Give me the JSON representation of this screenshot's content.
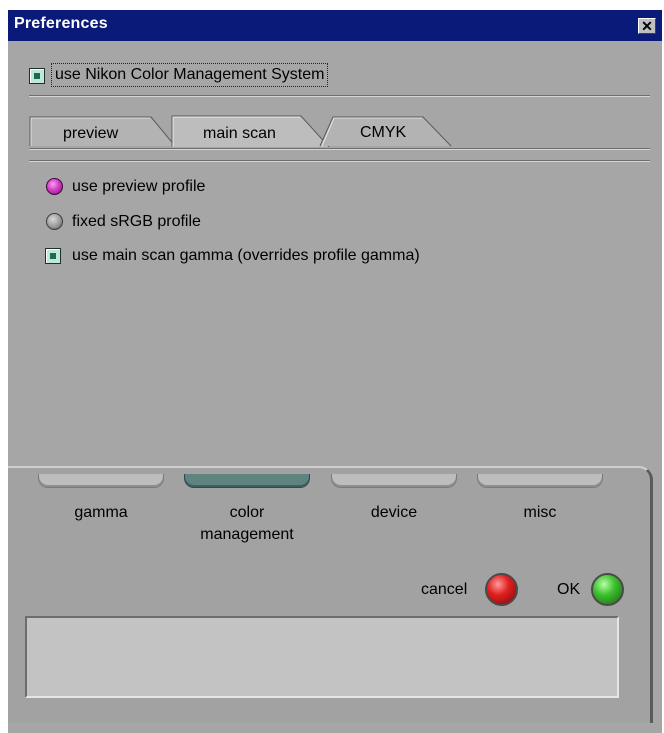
{
  "window": {
    "title": "Preferences"
  },
  "cms": {
    "label": "use Nikon Color Management System",
    "checked": true
  },
  "tabs": [
    {
      "label": "preview",
      "active": false
    },
    {
      "label": "main scan",
      "active": true
    },
    {
      "label": "CMYK",
      "active": false
    }
  ],
  "options": {
    "preview_profile": "use preview profile",
    "srgb_profile": "fixed sRGB profile",
    "main_scan_gamma": "use main scan gamma (overrides profile gamma)"
  },
  "nav": {
    "gamma": "gamma",
    "color_line1": "color",
    "color_line2": "management",
    "device": "device",
    "misc": "misc"
  },
  "actions": {
    "cancel": "cancel",
    "ok": "OK"
  },
  "colors": {
    "titlebar": "#0a1a78",
    "panel": "#a6a6a6",
    "accent_radio": "#d23ec6",
    "active_nav": "#5f8480"
  }
}
